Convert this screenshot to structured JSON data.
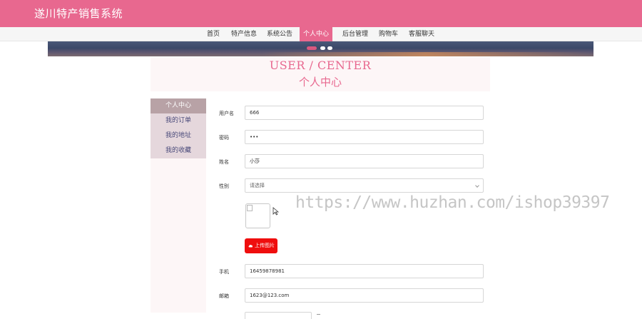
{
  "app": {
    "title": "遂川特产销售系统"
  },
  "nav": {
    "items": [
      {
        "label": "首页"
      },
      {
        "label": "特产信息"
      },
      {
        "label": "系统公告"
      },
      {
        "label": "个人中心",
        "active": true
      },
      {
        "label": "后台管理"
      },
      {
        "label": "购物车"
      },
      {
        "label": "客服聊天"
      }
    ]
  },
  "banner": {
    "dots": 3,
    "active_dot": 0
  },
  "page": {
    "title_en": "USER / CENTER",
    "title_zh": "个人中心"
  },
  "sidebar": {
    "items": [
      {
        "label": "个人中心",
        "active": true
      },
      {
        "label": "我的订单"
      },
      {
        "label": "我的地址"
      },
      {
        "label": "我的收藏"
      }
    ]
  },
  "form": {
    "username": {
      "label": "用户名",
      "value": "666"
    },
    "password": {
      "label": "密码",
      "value": "•••"
    },
    "name": {
      "label": "姓名",
      "value": "小莎"
    },
    "gender": {
      "label": "性别",
      "selected": "请选择"
    },
    "upload_button": "上传图片",
    "phone": {
      "label": "手机",
      "value": "16459878981"
    },
    "email": {
      "label": "邮箱",
      "value": "1623@123.com"
    }
  },
  "watermark": "https://www.huzhan.com/ishop39397",
  "colors": {
    "brand": "#e8688f",
    "upload": "#ef0e0e",
    "sidebar_active": "#b8a2a6",
    "sidebar_item": "#e5d7dc"
  }
}
